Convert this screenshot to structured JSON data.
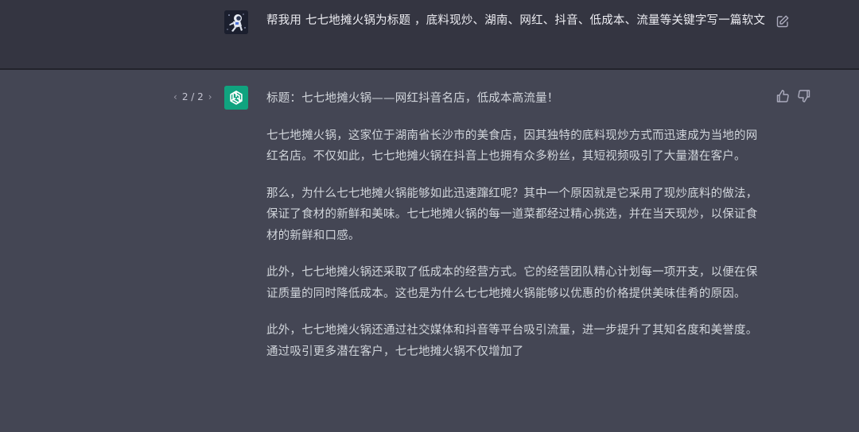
{
  "user_message": {
    "text": "帮我用 七七地摊火锅为标题 ，底料现炒、湖南、网红、抖音、低成本、流量等关键字写一篇软文",
    "avatar_icon": "astronaut-avatar-icon",
    "edit_icon": "edit-icon"
  },
  "assistant_message": {
    "pager": {
      "prev": "‹",
      "label": "2 / 2",
      "next": "›"
    },
    "avatar_icon": "openai-logo-icon",
    "paragraphs": [
      "标题：七七地摊火锅——网红抖音名店，低成本高流量！",
      "七七地摊火锅，这家位于湖南省长沙市的美食店，因其独特的底料现炒方式而迅速成为当地的网红名店。不仅如此，七七地摊火锅在抖音上也拥有众多粉丝，其短视频吸引了大量潜在客户。",
      "那么，为什么七七地摊火锅能够如此迅速蹿红呢？其中一个原因就是它采用了现炒底料的做法，保证了食材的新鲜和美味。七七地摊火锅的每一道菜都经过精心挑选，并在当天现炒，以保证食材的新鲜和口感。",
      "此外，七七地摊火锅还采取了低成本的经营方式。它的经营团队精心计划每一项开支，以便在保证质量的同时降低成本。这也是为什么七七地摊火锅能够以优惠的价格提供美味佳肴的原因。",
      "此外，七七地摊火锅还通过社交媒体和抖音等平台吸引流量，进一步提升了其知名度和美誉度。通过吸引更多潜在客户，七七地摊火锅不仅增加了"
    ],
    "feedback": {
      "thumb_up_icon": "thumbs-up-icon",
      "thumb_down_icon": "thumbs-down-icon"
    }
  },
  "colors": {
    "user_bg": "#343541",
    "assistant_bg": "#444654",
    "accent": "#10a37f",
    "text": "#d1d5db"
  }
}
